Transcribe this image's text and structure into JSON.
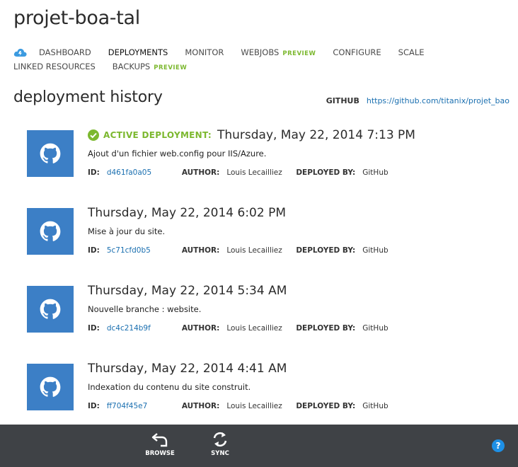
{
  "page": {
    "title": "projet-boa-tal"
  },
  "nav": {
    "row1": [
      {
        "label": "DASHBOARD"
      },
      {
        "label": "DEPLOYMENTS",
        "active": true
      },
      {
        "label": "MONITOR"
      },
      {
        "label": "WEBJOBS",
        "preview": "PREVIEW"
      },
      {
        "label": "CONFIGURE"
      },
      {
        "label": "SCALE"
      }
    ],
    "row2": [
      {
        "label": "LINKED RESOURCES"
      },
      {
        "label": "BACKUPS",
        "preview": "PREVIEW"
      }
    ]
  },
  "history": {
    "title": "deployment history",
    "repo_label": "GITHUB",
    "repo_url": "https://github.com/titanix/projet_bao"
  },
  "labels": {
    "id": "ID:",
    "author": "AUTHOR:",
    "deployed_by": "DEPLOYED BY:",
    "active": "ACTIVE DEPLOYMENT:"
  },
  "deployments": [
    {
      "active": true,
      "date": "Thursday, May 22, 2014 7:13 PM",
      "message": "Ajout d'un fichier web.config pour IIS/Azure.",
      "id": "d461fa0a05",
      "author": "Louis Lecailliez",
      "deployed_by": "GitHub"
    },
    {
      "active": false,
      "date": "Thursday, May 22, 2014 6:02 PM",
      "message": "Mise à jour du site.",
      "id": "5c71cfd0b5",
      "author": "Louis Lecailliez",
      "deployed_by": "GitHub"
    },
    {
      "active": false,
      "date": "Thursday, May 22, 2014 5:34 AM",
      "message": "Nouvelle branche : website.",
      "id": "dc4c214b9f",
      "author": "Louis Lecailliez",
      "deployed_by": "GitHub"
    },
    {
      "active": false,
      "date": "Thursday, May 22, 2014 4:41 AM",
      "message": "Indexation du contenu du site construit.",
      "id": "ff704f45e7",
      "author": "Louis Lecailliez",
      "deployed_by": "GitHub"
    }
  ],
  "bottombar": {
    "browse": "BROWSE",
    "sync": "SYNC",
    "help": "?"
  }
}
